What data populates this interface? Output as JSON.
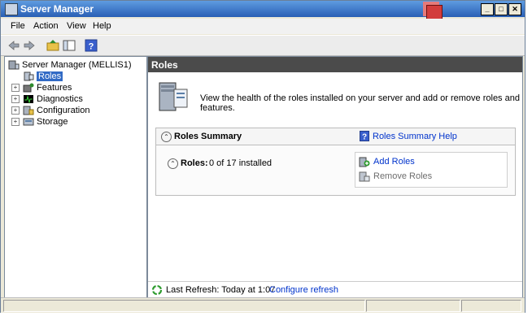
{
  "window": {
    "title": "Server Manager"
  },
  "menu": [
    "File",
    "Action",
    "View",
    "Help"
  ],
  "toolbar": {
    "icons": [
      "back-arrow-icon",
      "forward-arrow-icon",
      "up-folder-icon",
      "show-hide-tree-icon",
      "help-icon"
    ]
  },
  "tree": {
    "root": "Server Manager (MELLIS1)",
    "items": [
      {
        "label": "Roles",
        "selected": true,
        "expandable": false
      },
      {
        "label": "Features",
        "selected": false,
        "expandable": true
      },
      {
        "label": "Diagnostics",
        "selected": false,
        "expandable": true
      },
      {
        "label": "Configuration",
        "selected": false,
        "expandable": true
      },
      {
        "label": "Storage",
        "selected": false,
        "expandable": true
      }
    ]
  },
  "main": {
    "header": "Roles",
    "description": "View the health of the roles installed on your server and add or remove roles and features.",
    "summary": {
      "title": "Roles Summary",
      "help_link": "Roles Summary Help",
      "roles_label": "Roles:",
      "roles_value": "0 of 17 installed",
      "add_roles": "Add Roles",
      "remove_roles": "Remove Roles"
    },
    "status": {
      "last_refresh": "Last Refresh: Today at 1:07",
      "configure_refresh": "Configure refresh"
    }
  },
  "colors": {
    "header_bg": "#4b4b4b",
    "link": "#0033cc",
    "selection": "#316ac5",
    "title_bar": "#2a5fb5"
  }
}
